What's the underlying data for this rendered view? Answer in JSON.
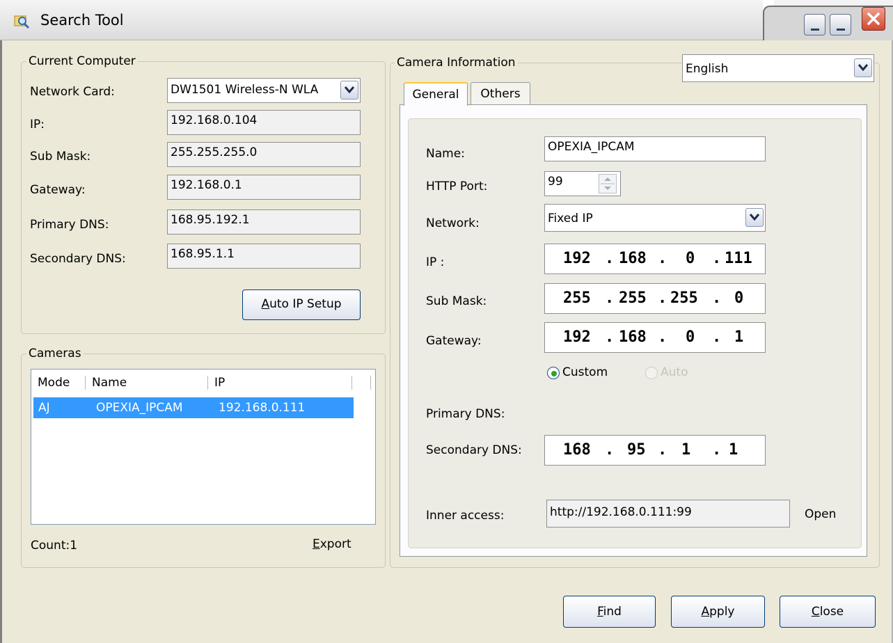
{
  "window": {
    "title": "Search Tool",
    "icon": "search-tool-icon"
  },
  "language": {
    "selected": "English"
  },
  "current_computer": {
    "title": "Current Computer",
    "network_card_label": "Network Card:",
    "network_card_value": "DW1501 Wireless-N WLA",
    "ip_label": "IP:",
    "ip_value": "192.168.0.104",
    "sub_mask_label": "Sub Mask:",
    "sub_mask_value": "255.255.255.0",
    "gateway_label": "Gateway:",
    "gateway_value": "192.168.0.1",
    "primary_dns_label": "Primary DNS:",
    "primary_dns_value": "168.95.192.1",
    "secondary_dns_label": "Secondary DNS:",
    "secondary_dns_value": "168.95.1.1",
    "auto_ip_button": {
      "mnemonic": "A",
      "rest": "uto IP Setup"
    }
  },
  "cameras": {
    "title": "Cameras",
    "columns": [
      "Mode",
      "Name",
      "IP"
    ],
    "rows": [
      {
        "mode": "AJ",
        "name": "OPEXIA_IPCAM",
        "ip": "192.168.0.111",
        "selected": true
      }
    ],
    "count_label": "Count:",
    "count_value": "1",
    "export": {
      "mnemonic": "E",
      "rest": "xport"
    }
  },
  "camera_info": {
    "title": "Camera Information",
    "tabs": [
      "General",
      "Others"
    ],
    "active_tab": "General",
    "name_label": "Name:",
    "name_value": "OPEXIA_IPCAM",
    "http_port_label": "HTTP Port:",
    "http_port_value": "99",
    "network_label": "Network:",
    "network_value": "Fixed IP",
    "ip_label": "IP :",
    "ip_octets": [
      "192",
      "168",
      "0",
      "111"
    ],
    "sub_mask_label": "Sub Mask:",
    "sub_mask_octets": [
      "255",
      "255",
      "255",
      "0"
    ],
    "gateway_label": "Gateway:",
    "gateway_octets": [
      "192",
      "168",
      "0",
      "1"
    ],
    "dns_mode": {
      "custom_label": "Custom",
      "auto_label": "Auto",
      "selected": "Custom"
    },
    "primary_dns_label": "Primary DNS:",
    "secondary_dns_label": "Secondary DNS:",
    "secondary_dns_octets": [
      "168",
      "95",
      "1",
      "1"
    ],
    "inner_access_label": "Inner access:",
    "inner_access_value": "http://192.168.0.111:99",
    "open_label": "Open"
  },
  "buttons": {
    "find": {
      "mnemonic": "F",
      "rest": "ind"
    },
    "apply": {
      "mnemonic": "A",
      "rest": "pply"
    },
    "close": {
      "mnemonic": "C",
      "rest": "lose"
    }
  },
  "colors": {
    "selection": "#3399ff",
    "tab_highlight": "#ffc83c",
    "close_button": "#d4472e"
  }
}
